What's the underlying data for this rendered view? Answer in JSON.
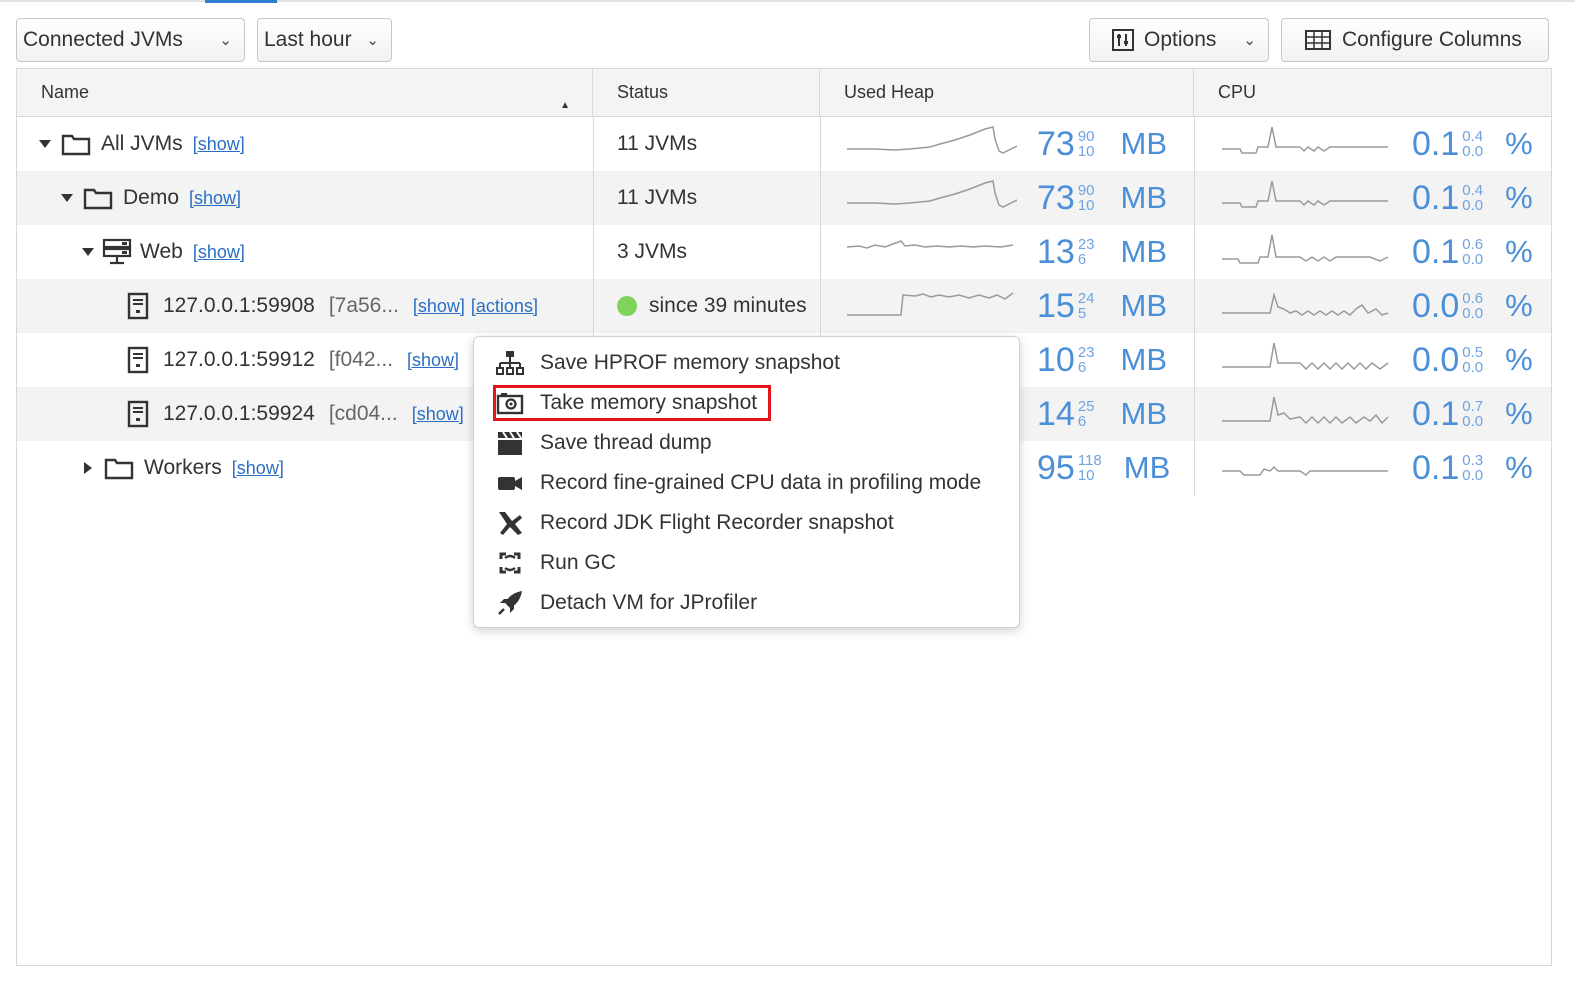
{
  "toolbar": {
    "connected_label": "Connected JVMs",
    "time_label": "Last hour",
    "options_label": "Options",
    "columns_label": "Configure Columns"
  },
  "columns": {
    "name": "Name",
    "status": "Status",
    "heap": "Used Heap",
    "cpu": "CPU"
  },
  "rows": [
    {
      "name": "All JVMs",
      "id": "",
      "show": "[show]",
      "actions": "",
      "status": "11 JVMs",
      "heap": "73",
      "heap_max": "90",
      "heap_min": "10",
      "heap_unit": "MB",
      "cpu": "0.1",
      "cpu_max": "0.4",
      "cpu_min": "0.0",
      "cpu_unit": "%"
    },
    {
      "name": "Demo",
      "id": "",
      "show": "[show]",
      "actions": "",
      "status": "11 JVMs",
      "heap": "73",
      "heap_max": "90",
      "heap_min": "10",
      "heap_unit": "MB",
      "cpu": "0.1",
      "cpu_max": "0.4",
      "cpu_min": "0.0",
      "cpu_unit": "%"
    },
    {
      "name": "Web",
      "id": "",
      "show": "[show]",
      "actions": "",
      "status": "3 JVMs",
      "heap": "13",
      "heap_max": "23",
      "heap_min": "6",
      "heap_unit": "MB",
      "cpu": "0.1",
      "cpu_max": "0.6",
      "cpu_min": "0.0",
      "cpu_unit": "%"
    },
    {
      "name": "127.0.0.1:59908",
      "id": "[7a56...",
      "show": "[show]",
      "actions": "[actions]",
      "status": "since 39 minutes",
      "heap": "15",
      "heap_max": "24",
      "heap_min": "5",
      "heap_unit": "MB",
      "cpu": "0.0",
      "cpu_max": "0.6",
      "cpu_min": "0.0",
      "cpu_unit": "%"
    },
    {
      "name": "127.0.0.1:59912",
      "id": "[f042...",
      "show": "[show]",
      "actions": "",
      "status": "",
      "heap": "10",
      "heap_max": "23",
      "heap_min": "6",
      "heap_unit": "MB",
      "cpu": "0.0",
      "cpu_max": "0.5",
      "cpu_min": "0.0",
      "cpu_unit": "%"
    },
    {
      "name": "127.0.0.1:59924",
      "id": "[cd04...",
      "show": "[show]",
      "actions": "",
      "status": "",
      "heap": "14",
      "heap_max": "25",
      "heap_min": "6",
      "heap_unit": "MB",
      "cpu": "0.1",
      "cpu_max": "0.7",
      "cpu_min": "0.0",
      "cpu_unit": "%"
    },
    {
      "name": "Workers",
      "id": "",
      "show": "[show]",
      "actions": "",
      "status": "",
      "heap": "95",
      "heap_max": "118",
      "heap_min": "10",
      "heap_unit": "MB",
      "cpu": "0.1",
      "cpu_max": "0.3",
      "cpu_min": "0.0",
      "cpu_unit": "%"
    }
  ],
  "context_menu": {
    "items": [
      {
        "label": "Save HPROF memory snapshot",
        "icon": "hierarchy-icon"
      },
      {
        "label": "Take memory snapshot",
        "icon": "camera-icon"
      },
      {
        "label": "Save thread dump",
        "icon": "clapperboard-icon"
      },
      {
        "label": "Record fine-grained CPU data in profiling mode",
        "icon": "video-camera-icon"
      },
      {
        "label": "Record JDK Flight Recorder snapshot",
        "icon": "airplane-icon"
      },
      {
        "label": "Run GC",
        "icon": "recycle-icon"
      },
      {
        "label": "Detach VM for JProfiler",
        "icon": "rocket-icon"
      }
    ],
    "highlighted_index": 1,
    "highlight_color": "#e3141a"
  },
  "colors": {
    "accent": "#2f7dd1",
    "metric_blue": "#4a8fd8",
    "link": "#2a6fc4",
    "status_green": "#7fd35a"
  }
}
